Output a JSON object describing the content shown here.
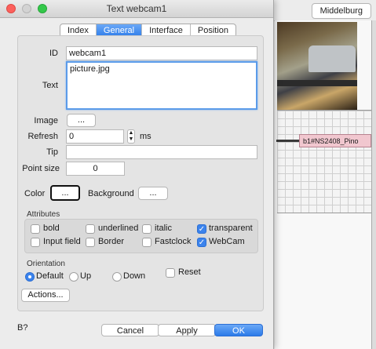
{
  "window": {
    "title": "Text webcam1"
  },
  "background": {
    "location_button": "Middelburg",
    "block_label": "b1#NS2408_Pino"
  },
  "tabs": [
    {
      "label": "Index",
      "active": false
    },
    {
      "label": "General",
      "active": true
    },
    {
      "label": "Interface",
      "active": false
    },
    {
      "label": "Position",
      "active": false
    }
  ],
  "form": {
    "id_label": "ID",
    "id_value": "webcam1",
    "text_label": "Text",
    "text_value": "picture.jpg",
    "image_label": "Image",
    "image_button": "...",
    "refresh_label": "Refresh",
    "refresh_value": "0",
    "refresh_unit": "ms",
    "tip_label": "Tip",
    "tip_value": "",
    "pointsize_label": "Point size",
    "pointsize_value": "0",
    "color_label": "Color",
    "color_button": "...",
    "background_label": "Background",
    "background_button": "..."
  },
  "attributes": {
    "title": "Attributes",
    "items": [
      {
        "label": "bold",
        "checked": false
      },
      {
        "label": "underlined",
        "checked": false
      },
      {
        "label": "italic",
        "checked": false
      },
      {
        "label": "transparent",
        "checked": true
      },
      {
        "label": "Input field",
        "checked": false
      },
      {
        "label": "Border",
        "checked": false
      },
      {
        "label": "Fastclock",
        "checked": false
      },
      {
        "label": "WebCam",
        "checked": true
      }
    ]
  },
  "orientation": {
    "title": "Orientation",
    "options": [
      {
        "label": "Default",
        "selected": true
      },
      {
        "label": "Up",
        "selected": false
      },
      {
        "label": "Down",
        "selected": false
      }
    ],
    "reset_label": "Reset",
    "reset_checked": false
  },
  "actions_button": "Actions...",
  "footer": {
    "cancel": "Cancel",
    "apply": "Apply",
    "ok": "OK"
  },
  "colors": {
    "accent": "#2f7de9",
    "close": "#fc605c",
    "maximize": "#34c84a",
    "block_fill": "#f1c7cf"
  }
}
